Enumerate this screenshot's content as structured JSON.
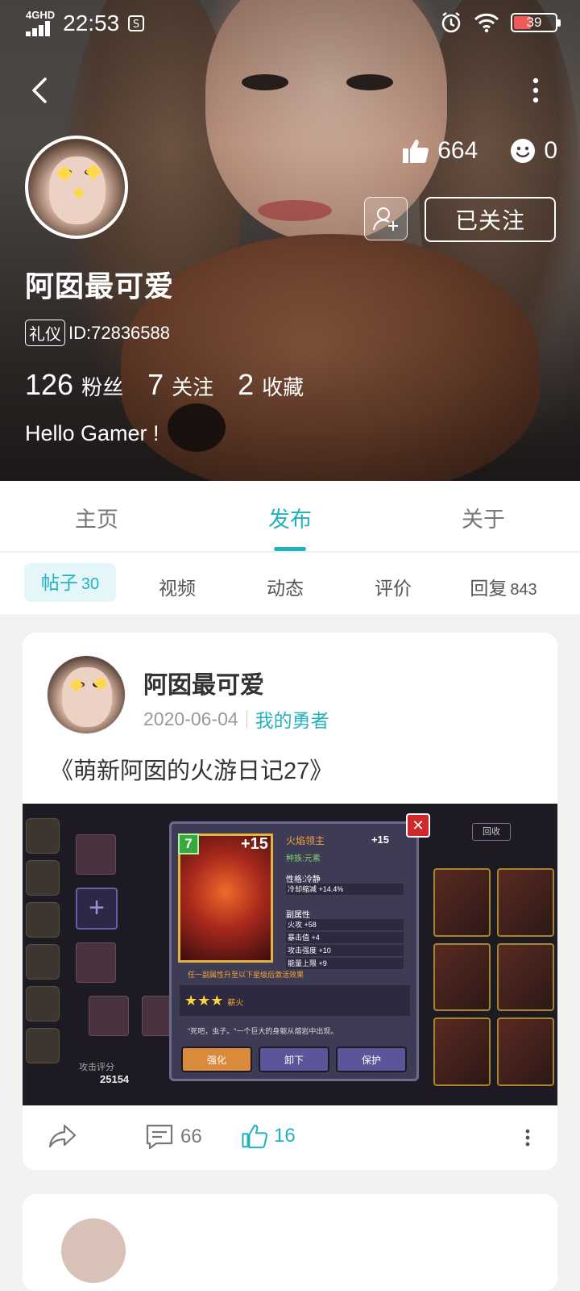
{
  "status_bar": {
    "network": "4G",
    "network_sub": "HD",
    "time": "22:53",
    "battery": "39"
  },
  "profile": {
    "nickname": "阿囡最可爱",
    "badge": "礼仪",
    "id_text": "ID:72836588",
    "likes": "664",
    "smiles": "0",
    "follow_label": "已关注",
    "fans_count": "126",
    "fans_label": "粉丝",
    "following_count": "7",
    "following_label": "关注",
    "favorites_count": "2",
    "favorites_label": "收藏",
    "bio": "Hello Gamer !"
  },
  "tabs": [
    {
      "label": "主页"
    },
    {
      "label": "发布"
    },
    {
      "label": "关于"
    }
  ],
  "active_tab": "发布",
  "subtabs": [
    {
      "label": "帖子",
      "count": "30"
    },
    {
      "label": "视频",
      "count": ""
    },
    {
      "label": "动态",
      "count": ""
    },
    {
      "label": "评价",
      "count": ""
    },
    {
      "label": "回复",
      "count": "843"
    }
  ],
  "post": {
    "author": "阿囡最可爱",
    "date": "2020-06-04",
    "category": "我的勇者",
    "title": "《萌新阿囡的火游日记27》",
    "comments": "66",
    "likes": "16",
    "game": {
      "level": "7",
      "plus": "+15",
      "name": "火焰领主",
      "plus_right": "+15",
      "race": "种族:元素",
      "trait": "性格:冷静",
      "trait_detail": "冷却缩减 +14.4%",
      "sub_title": "副属性",
      "sub1": "火攻 +58",
      "sub2": "暴击值 +4",
      "sub3": "攻击强度 +10",
      "sub4": "能量上限 +9",
      "note": "任一副属性升至以下星级后激活效果",
      "stars_label": "薪火",
      "quote": "\"死吧，虫子。\"一个巨大的身躯从熔岩中出现。",
      "btn1": "强化",
      "btn2": "卸下",
      "btn3": "保护",
      "attack_label": "攻击评分",
      "attack_value": "25154",
      "recycle": "回收"
    }
  },
  "colors": {
    "accent": "#22b2c0",
    "accent_bg": "#e4f6f8"
  }
}
